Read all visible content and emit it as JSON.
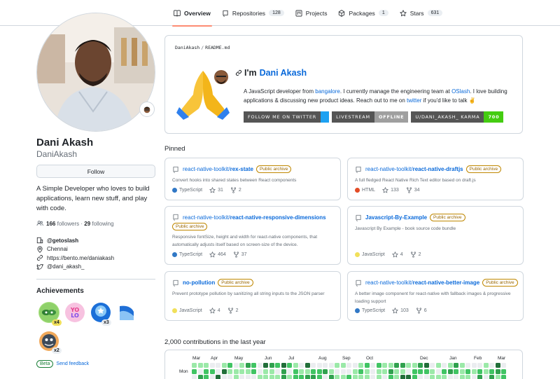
{
  "nav": {
    "tabs": [
      {
        "label": "Overview",
        "count": null,
        "icon": "book-icon"
      },
      {
        "label": "Repositories",
        "count": "128",
        "icon": "repo-icon"
      },
      {
        "label": "Projects",
        "count": null,
        "icon": "project-icon"
      },
      {
        "label": "Packages",
        "count": "1",
        "icon": "package-icon"
      },
      {
        "label": "Stars",
        "count": "631",
        "icon": "star-icon"
      }
    ],
    "active": "Overview"
  },
  "profile": {
    "full_name": "Dani Akash",
    "username": "DaniAkash",
    "follow_label": "Follow",
    "bio": "A Simple Developer who loves to build applications, learn new stuff, and play with code.",
    "followers": "166",
    "followers_label": "followers",
    "following": "29",
    "following_label": "following",
    "org": "@getoslash",
    "location": "Chennai",
    "website": "https://bento.me/daniakash",
    "twitter": "@dani_akash_"
  },
  "achievements": {
    "title": "Achievements",
    "items": [
      {
        "name": "pair-extraordinaire",
        "multiplier": "x4"
      },
      {
        "name": "yolo",
        "multiplier": ""
      },
      {
        "name": "starstruck",
        "multiplier": "x3"
      },
      {
        "name": "arctic-code-vault",
        "multiplier": ""
      },
      {
        "name": "pull-shark",
        "multiplier": "x2"
      }
    ],
    "beta_label": "Beta",
    "feedback_label": "Send feedback"
  },
  "readme": {
    "path_user": "DaniAkash",
    "path_file": "README.md",
    "heading_prefix": "I'm",
    "heading_name": "Dani Akash",
    "p1": "A JavaScript developer from ",
    "p1_link": "bangalore",
    "p2": ". I currently manage the engineering team at ",
    "p2_link": "OSlash",
    "p3": ". I love building applications & discussing new product ideas. Reach out to me on ",
    "p3_link": "twitter",
    "p4": " if you'd like to talk ✌",
    "shields": [
      {
        "left": "FOLLOW ME ON TWITTER",
        "right": "",
        "left_color": "#555555",
        "right_color": "#1da1f2"
      },
      {
        "left": "LIVESTREAM",
        "right": "OFFLINE",
        "left_color": "#555555",
        "right_color": "#9f9f9f"
      },
      {
        "left": "U/DANI_AKASH_ KARMA",
        "right": "700",
        "left_color": "#555555",
        "right_color": "#4c1"
      }
    ]
  },
  "pinned": {
    "title": "Pinned",
    "items": [
      {
        "owner": "react-native-toolkit/",
        "repo": "rex-state",
        "badge": "Public archive",
        "desc": "Convert hooks into shared states between React components",
        "lang": "TypeScript",
        "lang_color": "#3178c6",
        "stars": "31",
        "forks": "2"
      },
      {
        "owner": "react-native-toolkit/",
        "repo": "react-native-draftjs",
        "badge": "Public archive",
        "desc": "A full fledged React Native Rich Text editor based on draft.js",
        "lang": "HTML",
        "lang_color": "#e34c26",
        "stars": "133",
        "forks": "34"
      },
      {
        "owner": "react-native-toolkit/",
        "repo": "react-native-responsive-dimensions",
        "badge": "Public archive",
        "desc": "Responsive fontSize, height and width for react-native components, that automatically adjusts itself based on screen-size of the device.",
        "lang": "TypeScript",
        "lang_color": "#3178c6",
        "stars": "464",
        "forks": "37"
      },
      {
        "owner": "",
        "repo": "Javascript-By-Example",
        "badge": "Public archive",
        "desc": "Javascript By Example - book source code bundle",
        "lang": "JavaScript",
        "lang_color": "#f1e05a",
        "stars": "4",
        "forks": "2"
      },
      {
        "owner": "",
        "repo": "no-pollution",
        "badge": "Public archive",
        "desc": "Prevent prototype pollution by sanitizing all string inputs to the JSON parser",
        "lang": "JavaScript",
        "lang_color": "#f1e05a",
        "stars": "4",
        "forks": "2"
      },
      {
        "owner": "react-native-toolkit/",
        "repo": "react-native-better-image",
        "badge": "Public archive",
        "desc": "A better image component for react-native with fallback images & progressive loading support",
        "lang": "TypeScript",
        "lang_color": "#3178c6",
        "stars": "103",
        "forks": "6"
      }
    ]
  },
  "contributions": {
    "title": "2,000 contributions in the last year",
    "months": [
      "Mar",
      "Apr",
      "May",
      "Jun",
      "Jul",
      "Aug",
      "Sep",
      "Oct",
      "Dec",
      "Jan",
      "Feb",
      "Mar"
    ],
    "day_label": "Mon",
    "colors": [
      "#ebedf0",
      "#9be9a8",
      "#40c463",
      "#30a14e",
      "#216e39"
    ]
  }
}
